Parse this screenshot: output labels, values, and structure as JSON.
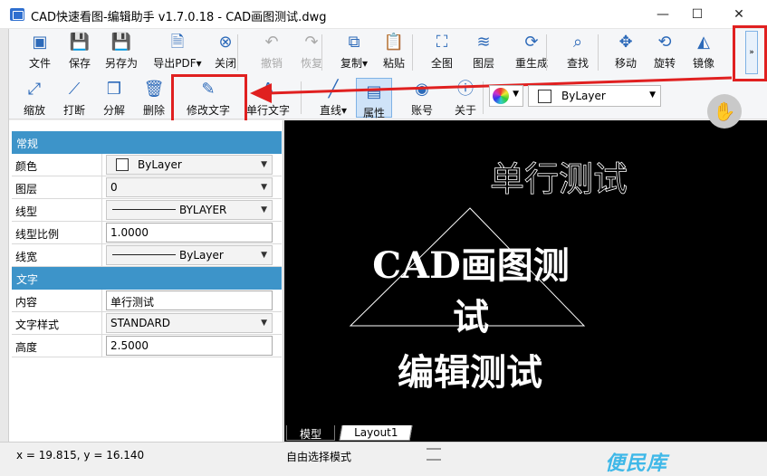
{
  "window": {
    "title": "CAD快速看图-编辑助手 v1.7.0.18 - CAD画图测试.dwg",
    "controls": [
      "—",
      "☐",
      "✕"
    ]
  },
  "toolbar1": [
    {
      "label": "文件",
      "icon": "file-icon",
      "glyph": "▣"
    },
    {
      "label": "保存",
      "icon": "save-icon",
      "glyph": "💾"
    },
    {
      "label": "另存为",
      "icon": "save-as-icon",
      "glyph": "💾"
    },
    {
      "label": "导出PDF▾",
      "icon": "pdf-icon",
      "glyph": "🗎"
    },
    {
      "label": "关闭",
      "icon": "close-circle-icon",
      "glyph": "⊗"
    },
    {
      "label": "撤销",
      "icon": "undo-icon",
      "glyph": "↶"
    },
    {
      "label": "恢复",
      "icon": "redo-icon",
      "glyph": "↷"
    },
    {
      "label": "复制▾",
      "icon": "copy-icon",
      "glyph": "⧉"
    },
    {
      "label": "粘贴",
      "icon": "paste-icon",
      "glyph": "📋"
    },
    {
      "label": "全图",
      "icon": "fit-all-icon",
      "glyph": "⛶"
    },
    {
      "label": "图层",
      "icon": "layers-icon",
      "glyph": "≋"
    },
    {
      "label": "重生成",
      "icon": "regen-icon",
      "glyph": "⟳"
    },
    {
      "label": "查找",
      "icon": "find-icon",
      "glyph": "⌕"
    },
    {
      "label": "移动",
      "icon": "move-icon",
      "glyph": "✥"
    },
    {
      "label": "旋转",
      "icon": "rotate-icon",
      "glyph": "⟲"
    },
    {
      "label": "镜像",
      "icon": "mirror-icon",
      "glyph": "◭"
    }
  ],
  "toolbar2": [
    {
      "label": "缩放",
      "icon": "scale-icon",
      "glyph": "⤢"
    },
    {
      "label": "打断",
      "icon": "break-icon",
      "glyph": "⟋"
    },
    {
      "label": "分解",
      "icon": "explode-icon",
      "glyph": "❒"
    },
    {
      "label": "删除",
      "icon": "delete-icon",
      "glyph": "🗑"
    },
    {
      "label": "修改文字",
      "icon": "edit-text-icon",
      "glyph": "✎"
    },
    {
      "label": "单行文字",
      "icon": "single-line-text-icon",
      "glyph": "A"
    },
    {
      "label": "直线▾",
      "icon": "line-icon",
      "glyph": "╱"
    },
    {
      "label": "属性",
      "icon": "properties-icon",
      "glyph": "▤"
    },
    {
      "label": "账号",
      "icon": "account-icon",
      "glyph": "◉"
    },
    {
      "label": "关于",
      "icon": "about-icon",
      "glyph": "ⓘ"
    }
  ],
  "more_button_label": "»",
  "layer_dropdown": {
    "value": "ByLayer"
  },
  "properties": {
    "sections": [
      {
        "title": "常规",
        "rows": [
          {
            "key": "颜色",
            "value": "ByLayer",
            "kind": "color"
          },
          {
            "key": "图层",
            "value": "0",
            "kind": "dropdown"
          },
          {
            "key": "线型",
            "value": "BYLAYER",
            "kind": "linetype"
          },
          {
            "key": "线型比例",
            "value": "1.0000",
            "kind": "input"
          },
          {
            "key": "线宽",
            "value": "ByLayer",
            "kind": "lineweight"
          }
        ]
      },
      {
        "title": "文字",
        "rows": [
          {
            "key": "内容",
            "value": "单行测试",
            "kind": "input"
          },
          {
            "key": "文字样式",
            "value": "STANDARD",
            "kind": "dropdown"
          },
          {
            "key": "高度",
            "value": "2.5000",
            "kind": "input"
          }
        ]
      }
    ]
  },
  "drawing": {
    "text_single_line": "单行测试",
    "text_main_1": "CAD画图测",
    "text_main_2": "试",
    "text_main_3": "编辑测试"
  },
  "tabs": [
    "模型",
    "Layout1"
  ],
  "status": {
    "coords": "x = 19.815, y = 16.140",
    "mode": "自由选择模式"
  },
  "watermark": "便民库",
  "colors": {
    "accent": "#3d94c9",
    "highlight": "#e02020",
    "canvas": "#000000"
  }
}
